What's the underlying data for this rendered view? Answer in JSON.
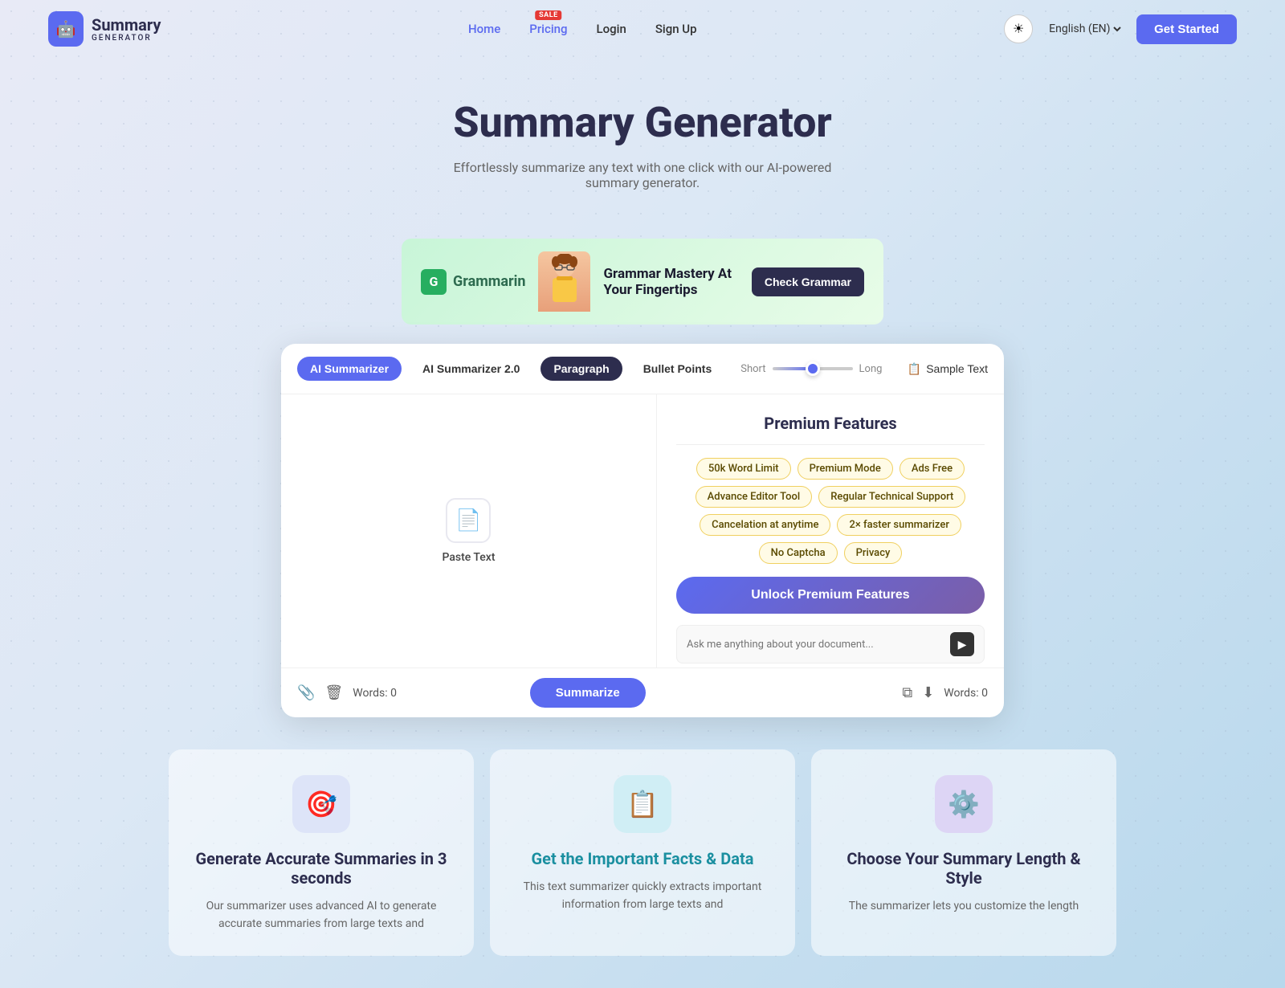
{
  "site": {
    "logo_summary": "Summary",
    "logo_generator": "GENERATOR",
    "logo_icon": "🤖"
  },
  "navbar": {
    "home": "Home",
    "pricing": "Pricing",
    "pricing_badge": "SALE",
    "login": "Login",
    "signup": "Sign Up",
    "language": "English (EN)",
    "get_started": "Get Started"
  },
  "hero": {
    "title": "Summary Generator",
    "subtitle": "Effortlessly summarize any text with one click with our AI-powered summary generator."
  },
  "banner": {
    "brand": "Grammarin",
    "tagline": "Grammar Mastery At Your Fingertips",
    "cta": "Check Grammar"
  },
  "tool": {
    "tabs": [
      {
        "label": "AI Summarizer",
        "state": "active-blue"
      },
      {
        "label": "AI Summarizer 2.0",
        "state": "inactive"
      },
      {
        "label": "Paragraph",
        "state": "active-dark"
      },
      {
        "label": "Bullet Points",
        "state": "inactive"
      }
    ],
    "slider": {
      "short_label": "Short",
      "long_label": "Long"
    },
    "sample_text_btn": "Sample Text",
    "paste_text_label": "Paste Text",
    "words_count_left": "Words: 0",
    "summarize_btn": "Summarize",
    "words_count_right": "Words: 0"
  },
  "premium": {
    "title": "Premium Features",
    "features": [
      "50k Word Limit",
      "Premium Mode",
      "Ads Free",
      "Advance Editor Tool",
      "Regular Technical Support",
      "Cancelation at anytime",
      "2× faster summarizer",
      "No Captcha",
      "Privacy"
    ],
    "unlock_btn": "Unlock Premium Features",
    "ask_placeholder": "Ask me anything about your document..."
  },
  "bottom_cards": [
    {
      "icon": "🎯",
      "icon_class": "blue-bg",
      "title": "Generate Accurate Summaries in 3 seconds",
      "title_class": "",
      "desc": "Our summarizer uses advanced AI to generate accurate summaries from large texts and"
    },
    {
      "icon": "📋",
      "icon_class": "teal-bg",
      "title": "Get the Important Facts & Data",
      "title_class": "teal",
      "desc": "This text summarizer quickly extracts important information from large texts and"
    },
    {
      "icon": "⚙️",
      "icon_class": "purple-bg",
      "title": "Choose Your Summary Length & Style",
      "title_class": "",
      "desc": "The summarizer lets you customize the length"
    }
  ]
}
